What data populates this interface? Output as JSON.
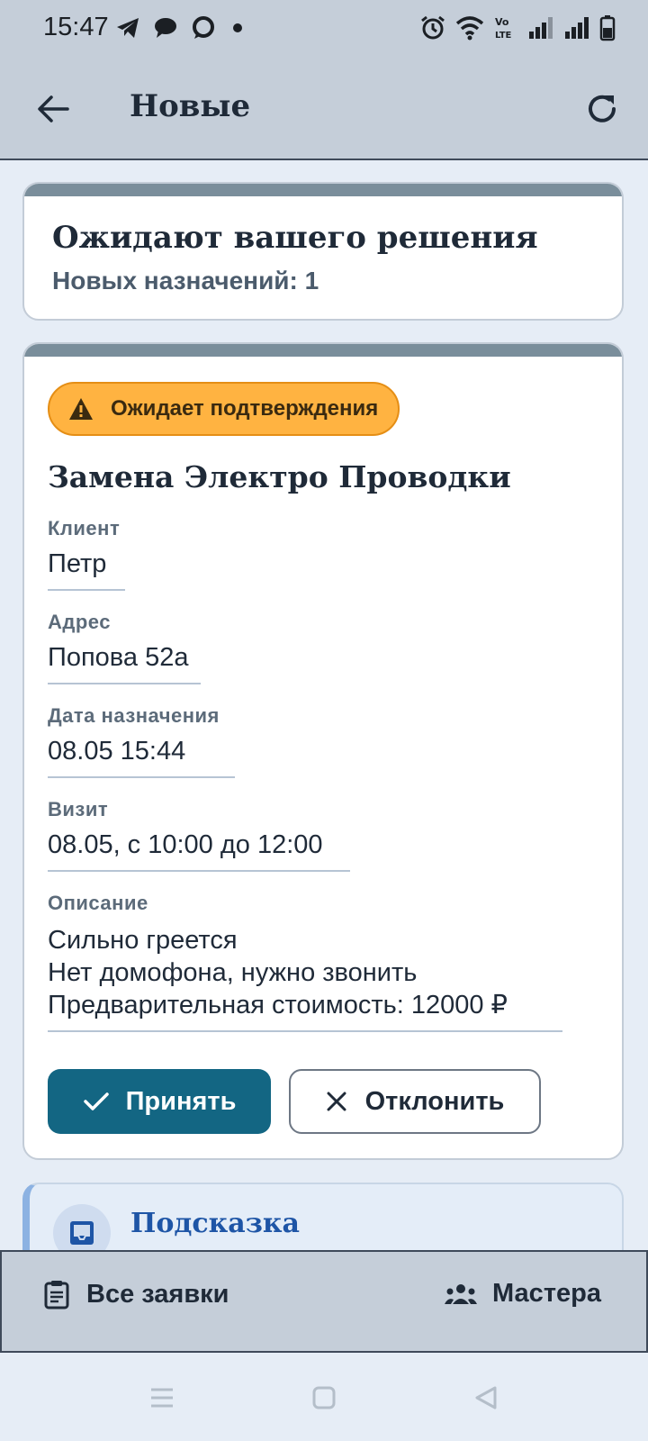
{
  "status_bar": {
    "time": "15:47",
    "left_icons": [
      "telegram-icon",
      "message-icon",
      "chat-bubble-icon",
      "dot-icon"
    ],
    "right_icons": [
      "alarm-icon",
      "wifi-icon",
      "volte-icon",
      "signal-icon",
      "signal-icon",
      "battery-icon"
    ]
  },
  "app_bar": {
    "title": "Новые",
    "back_icon": "arrow-left-icon",
    "refresh_icon": "refresh-icon"
  },
  "summary": {
    "title": "Ожидают вашего решения",
    "count_text": "Новых назначений: 1"
  },
  "order": {
    "status_badge": "Ожидает подтверждения",
    "badge_color": "#ffb341",
    "title": "Замена Электро Проводки",
    "fields": [
      {
        "label": "Клиент",
        "value": "Петр"
      },
      {
        "label": "Адрес",
        "value": "Попова 52а"
      },
      {
        "label": "Дата назначения",
        "value": "08.05 15:44"
      },
      {
        "label": "Визит",
        "value": "08.05, с 10:00 до 12:00"
      }
    ],
    "description_label": "Описание",
    "description_lines": [
      "Сильно греется",
      "Нет домофона, нужно звонить",
      "Предварительная стоимость: 12000 ₽"
    ],
    "accept_label": "Принять",
    "decline_label": "Отклонить",
    "accept_color": "#136683"
  },
  "hint": {
    "title": "Подсказка"
  },
  "bottom_nav": {
    "left_label": "Все заявки",
    "right_label": "Мастера"
  },
  "system_nav": [
    "menu-icon",
    "home-icon",
    "back-triangle-icon"
  ]
}
